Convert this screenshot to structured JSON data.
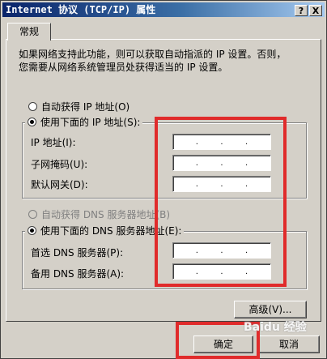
{
  "window": {
    "title": "Internet 协议 (TCP/IP) 属性",
    "help_button": "?",
    "close_button": "X"
  },
  "tabs": [
    {
      "label": "常规"
    }
  ],
  "description": {
    "line1": "如果网络支持此功能，则可以获取自动指派的 IP 设置。否则，",
    "line2": "您需要从网络系统管理员处获得适当的 IP 设置。"
  },
  "ip_mode": {
    "auto_label": "自动获得 IP 地址(O)",
    "manual_label": "使用下面的 IP 地址(S):",
    "selected": "manual"
  },
  "ip_fields": [
    {
      "label": "IP 地址(I):",
      "value": ".  .  ."
    },
    {
      "label": "子网掩码(U):",
      "value": ".  .  ."
    },
    {
      "label": "默认网关(D):",
      "value": ".  .  ."
    }
  ],
  "dns_mode": {
    "auto_label": "自动获得 DNS 服务器地址(B)",
    "manual_label": "使用下面的 DNS 服务器地址(E):",
    "selected": "manual"
  },
  "dns_fields": [
    {
      "label": "首选 DNS 服务器(P):",
      "value": ".  .  ."
    },
    {
      "label": "备用 DNS 服务器(A):",
      "value": ".  .  ."
    }
  ],
  "buttons": {
    "advanced": "高级(V)...",
    "ok": "确定",
    "cancel": "取消"
  },
  "watermark": "Baidu 经验",
  "colors": {
    "annotation": "#e02b2b",
    "titlebar": "#0a246a",
    "face": "#d4d0c8"
  }
}
